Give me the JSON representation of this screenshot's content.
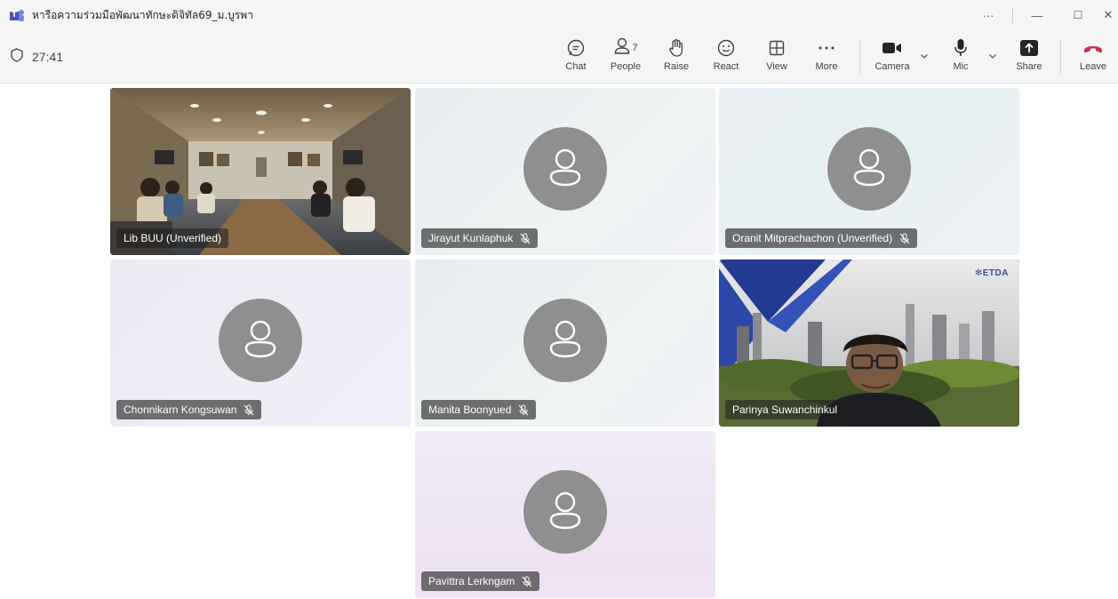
{
  "window": {
    "title": "หารือความร่วมมือพัฒนาทักษะดิจิทัล69_ม.บูรพา",
    "more_label": "···",
    "minimize_label": "—",
    "maximize_label": "☐",
    "close_label": "✕"
  },
  "meeting": {
    "timer": "27:41",
    "participant_count": "7"
  },
  "toolbar": {
    "chat": "Chat",
    "people": "People",
    "raise": "Raise",
    "react": "React",
    "view": "View",
    "more": "More",
    "camera": "Camera",
    "mic": "Mic",
    "share": "Share",
    "leave": "Leave"
  },
  "participants": [
    {
      "name": "Lib BUU (Unverified)",
      "muted": false,
      "video": true
    },
    {
      "name": "Jirayut Kunlaphuk",
      "muted": true,
      "video": false
    },
    {
      "name": "Oranit Mitprachachon (Unverified)",
      "muted": true,
      "video": false
    },
    {
      "name": "Chonnikarn Kongsuwan",
      "muted": true,
      "video": false
    },
    {
      "name": "Manita Boonyued",
      "muted": true,
      "video": false
    },
    {
      "name": "Parinya Suwanchinkul",
      "muted": false,
      "video": true,
      "active_speaker": true
    },
    {
      "name": "Pavittra Lerkngam",
      "muted": true,
      "video": false
    }
  ],
  "video_overlay": {
    "etda_logo": "ETDA"
  },
  "colors": {
    "accent": "#6264a7",
    "leave": "#c4314b",
    "avatar": "#8f8f8f"
  }
}
